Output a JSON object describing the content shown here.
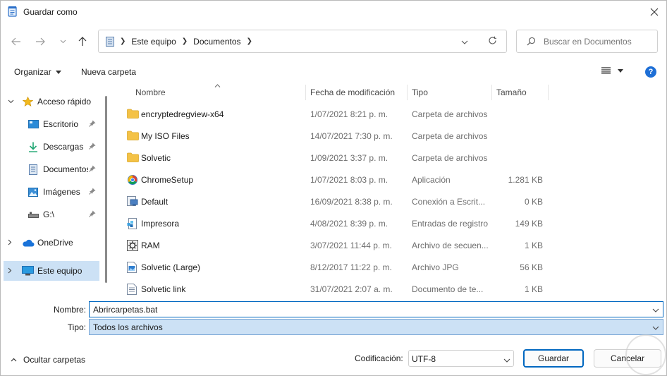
{
  "window": {
    "title": "Guardar como"
  },
  "address": {
    "crumbs": [
      "Este equipo",
      "Documentos"
    ]
  },
  "search": {
    "placeholder": "Buscar en Documentos"
  },
  "commands": {
    "organize": "Organizar",
    "new_folder": "Nueva carpeta",
    "help": "?"
  },
  "nav": {
    "items": [
      {
        "label": "Acceso rápido",
        "icon": "star-icon"
      },
      {
        "label": "Escritorio",
        "icon": "desktop-icon"
      },
      {
        "label": "Descargas",
        "icon": "download-icon"
      },
      {
        "label": "Documentos",
        "icon": "document-icon"
      },
      {
        "label": "Imágenes",
        "icon": "pictures-icon"
      },
      {
        "label": "G:\\",
        "icon": "drive-icon"
      },
      {
        "label": "OneDrive",
        "icon": "cloud-icon"
      },
      {
        "label": "Este equipo",
        "icon": "computer-icon"
      }
    ]
  },
  "columns": {
    "name": "Nombre",
    "date": "Fecha de modificación",
    "type": "Tipo",
    "size": "Tamaño"
  },
  "files": [
    {
      "name": "encryptedregview-x64",
      "date": "1/07/2021 8:21 p. m.",
      "type": "Carpeta de archivos",
      "size": "",
      "icon": "folder-icon"
    },
    {
      "name": "My ISO Files",
      "date": "14/07/2021 7:30 p. m.",
      "type": "Carpeta de archivos",
      "size": "",
      "icon": "folder-icon"
    },
    {
      "name": "Solvetic",
      "date": "1/09/2021 3:37 p. m.",
      "type": "Carpeta de archivos",
      "size": "",
      "icon": "folder-icon"
    },
    {
      "name": "ChromeSetup",
      "date": "1/07/2021 8:03 p. m.",
      "type": "Aplicación",
      "size": "1.281 KB",
      "icon": "installer-icon"
    },
    {
      "name": "Default",
      "date": "16/09/2021 8:38 p. m.",
      "type": "Conexión a Escrit...",
      "size": "0 KB",
      "icon": "remote-desktop-icon"
    },
    {
      "name": "Impresora",
      "date": "4/08/2021 8:39 p. m.",
      "type": "Entradas de registro",
      "size": "149 KB",
      "icon": "registry-file-icon"
    },
    {
      "name": "RAM",
      "date": "3/07/2021 11:44 p. m.",
      "type": "Archivo de secuen...",
      "size": "1 KB",
      "icon": "script-file-icon"
    },
    {
      "name": "Solvetic (Large)",
      "date": "8/12/2017 11:22 p. m.",
      "type": "Archivo JPG",
      "size": "56 KB",
      "icon": "image-file-icon"
    },
    {
      "name": "Solvetic link",
      "date": "31/07/2021 2:07 a. m.",
      "type": "Documento de te...",
      "size": "1 KB",
      "icon": "text-file-icon"
    }
  ],
  "form": {
    "name_label": "Nombre:",
    "name_value": "Abrircarpetas.bat",
    "type_label": "Tipo:",
    "type_value": "Todos los archivos",
    "encoding_label": "Codificación:",
    "encoding_value": "UTF-8"
  },
  "footer": {
    "hide_folders": "Ocultar carpetas",
    "save": "Guardar",
    "cancel": "Cancelar"
  },
  "colors": {
    "accent": "#0067c0",
    "selection": "#cce1f5",
    "folder": "#f4c246"
  }
}
